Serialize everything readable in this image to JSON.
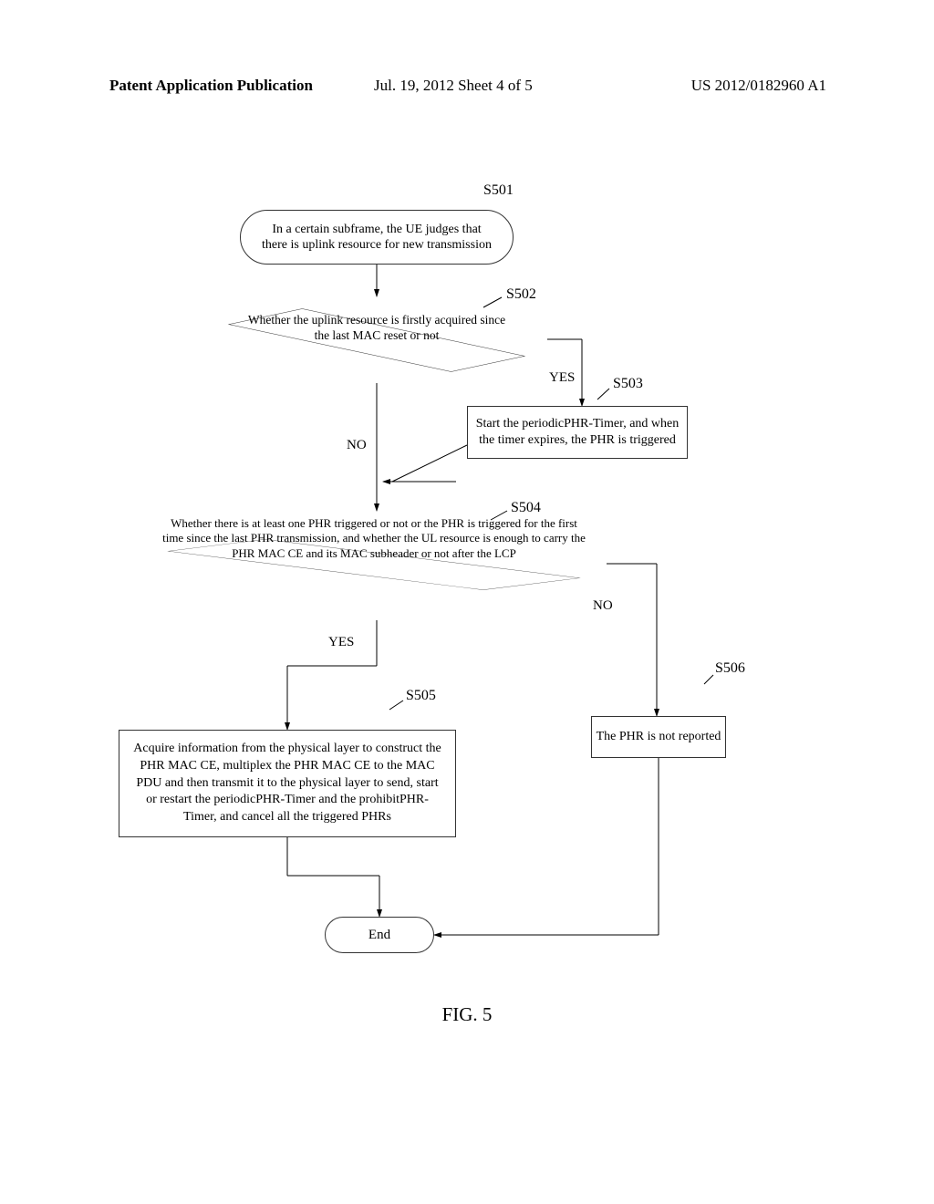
{
  "header": {
    "left": "Patent Application Publication",
    "center": "Jul. 19, 2012  Sheet 4 of 5",
    "right": "US 2012/0182960 A1"
  },
  "labels": {
    "S501": "S501",
    "S502": "S502",
    "S503": "S503",
    "S504": "S504",
    "S505": "S505",
    "S506": "S506",
    "YES_1": "YES",
    "NO_1": "NO",
    "YES_2": "YES",
    "NO_2": "NO"
  },
  "nodes": {
    "start": "In a certain subframe, the UE judges that there is uplink resource for new transmission",
    "d1": "Whether the uplink resource is firstly acquired since the last MAC reset or not",
    "s503": "Start the periodicPHR-Timer, and when the timer expires, the PHR is triggered",
    "d2": "Whether there is at least one PHR triggered or not or the PHR is triggered for the first time since the last PHR transmission, and whether the UL resource is enough to carry the PHR MAC CE and its MAC subheader or not after the LCP",
    "s505": "Acquire information from the physical layer to construct the PHR MAC CE, multiplex the PHR MAC CE to the MAC PDU and then transmit it to the physical layer to send, start or restart the periodicPHR-Timer and the prohibitPHR-Timer, and cancel all the triggered PHRs",
    "s506": "The PHR is not reported",
    "end": "End"
  },
  "figure": "FIG. 5"
}
